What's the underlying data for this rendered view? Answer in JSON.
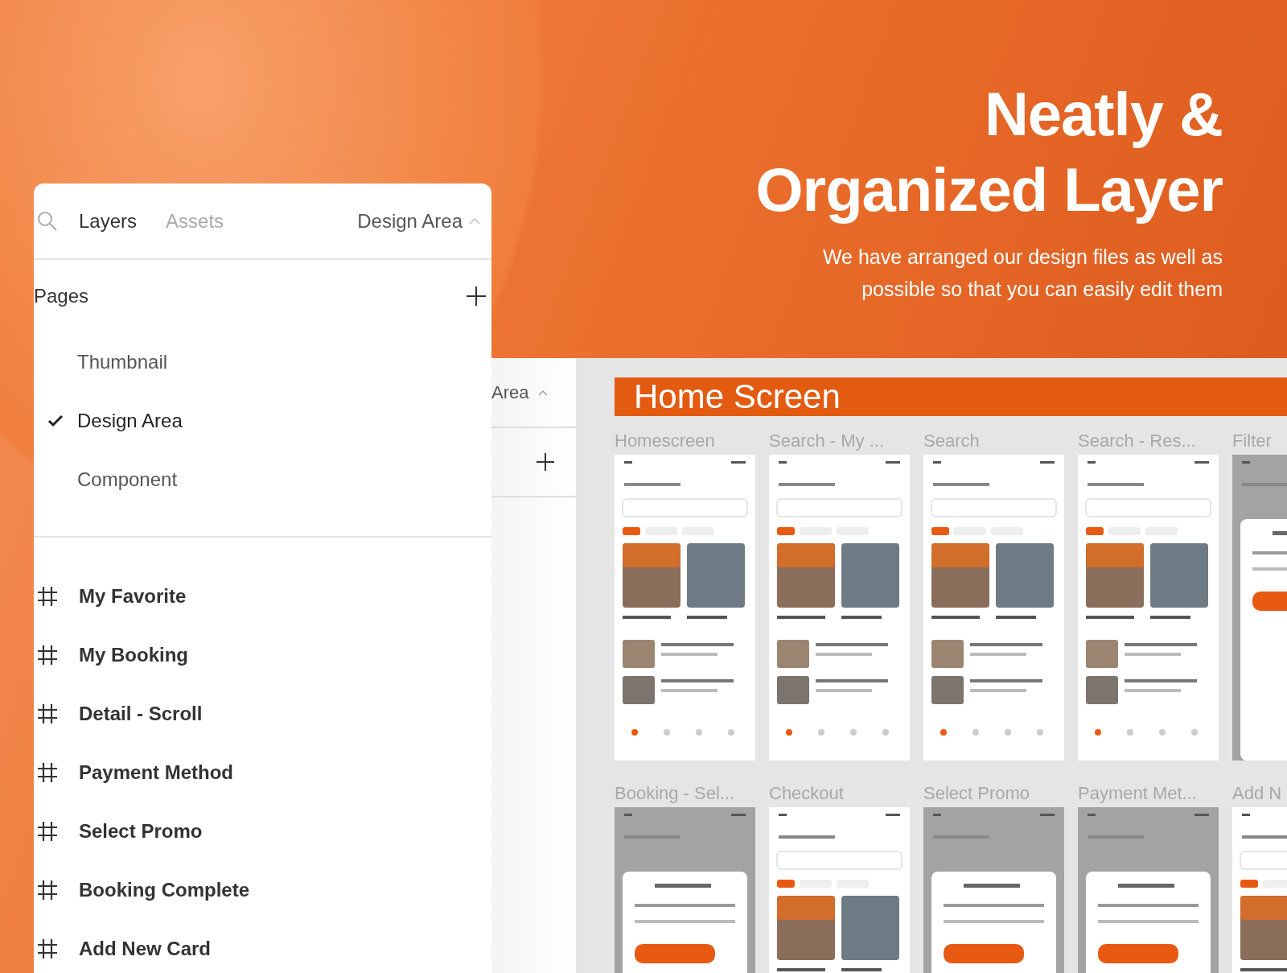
{
  "headline": {
    "lines": [
      "Neatly &",
      "Organized Layer"
    ],
    "subtitle_lines": [
      "We have arranged our design files as well as",
      "possible so that you can easily edit them"
    ]
  },
  "back_panel": {
    "page_label": "Area"
  },
  "canvas": {
    "section_title": "Home Screen",
    "frames": [
      {
        "label": "Homescreen",
        "dimmed": false
      },
      {
        "label": "Search - My ...",
        "dimmed": false
      },
      {
        "label": "Search",
        "dimmed": false
      },
      {
        "label": "Search - Res...",
        "dimmed": false
      },
      {
        "label": "Filter",
        "dimmed": true
      },
      {
        "label": "Booking - Sel...",
        "dimmed": true
      },
      {
        "label": "Checkout",
        "dimmed": false
      },
      {
        "label": "Select Promo",
        "dimmed": true
      },
      {
        "label": "Payment Met...",
        "dimmed": true
      },
      {
        "label": "Add N",
        "dimmed": false
      }
    ]
  },
  "panel": {
    "tabs": [
      {
        "label": "Layers",
        "selected": true
      },
      {
        "label": "Assets",
        "selected": false
      }
    ],
    "current_page": "Design Area",
    "pages_title": "Pages",
    "pages": [
      {
        "label": "Thumbnail",
        "selected": false
      },
      {
        "label": "Design Area",
        "selected": true
      },
      {
        "label": "Component",
        "selected": false
      }
    ],
    "layers": [
      "My Favorite",
      "My Booking",
      "Detail - Scroll",
      "Payment Method",
      "Select Promo",
      "Booking Complete",
      "Add New Card"
    ]
  }
}
